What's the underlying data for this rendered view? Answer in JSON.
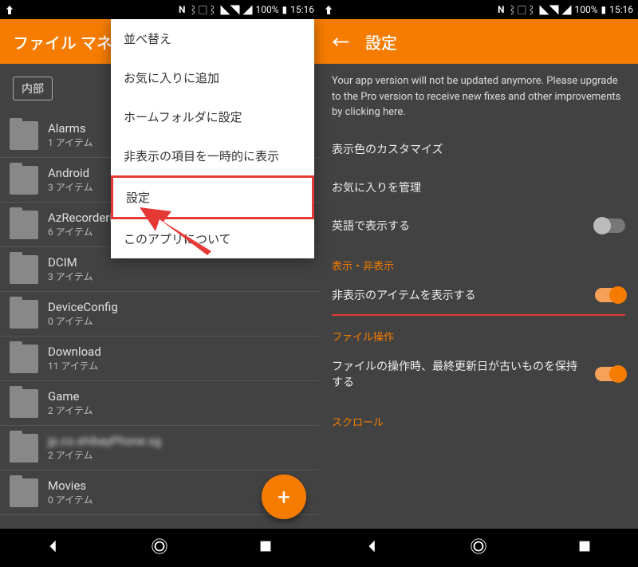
{
  "status": {
    "upload": "⬆",
    "nfc": "N",
    "vibrate": "📳",
    "wifi": "📶",
    "signal": "◢",
    "battery": "100%",
    "batt_icon": "▮",
    "time": "15:16"
  },
  "left": {
    "title": "ファイル マネージャー",
    "chip": "内部",
    "files": [
      {
        "name": "Alarms",
        "sub": "1 アイテム"
      },
      {
        "name": "Android",
        "sub": "3 アイテム"
      },
      {
        "name": "AzRecorderFree",
        "sub": "6 アイテム"
      },
      {
        "name": "DCIM",
        "sub": "3 アイテム"
      },
      {
        "name": "DeviceConfig",
        "sub": "0 アイテム"
      },
      {
        "name": "Download",
        "sub": "11 アイテム"
      },
      {
        "name": "Game",
        "sub": "2 アイテム"
      },
      {
        "name": "jp.co.shibayPhone.sg",
        "sub": "2 アイテム",
        "blur": true
      },
      {
        "name": "Movies",
        "sub": "0 アイテム"
      }
    ],
    "menu": [
      "並べ替え",
      "お気に入りに追加",
      "ホームフォルダに設定",
      "非表示の項目を一時的に表示",
      "設定",
      "このアプリについて"
    ],
    "fab": "+"
  },
  "right": {
    "title": "設定",
    "notice": "Your app version will not be updated anymore. Please upgrade to the Pro version to receive new fixes and other improvements by clicking here.",
    "pref_color": "表示色のカスタマイズ",
    "pref_fav": "お気に入りを管理",
    "pref_english": "英語で表示する",
    "cat_vis": "表示・非表示",
    "pref_hidden": "非表示のアイテムを表示する",
    "cat_file": "ファイル操作",
    "pref_keep": "ファイルの操作時、最終更新日が古いものを保持する",
    "cat_scroll": "スクロール"
  }
}
